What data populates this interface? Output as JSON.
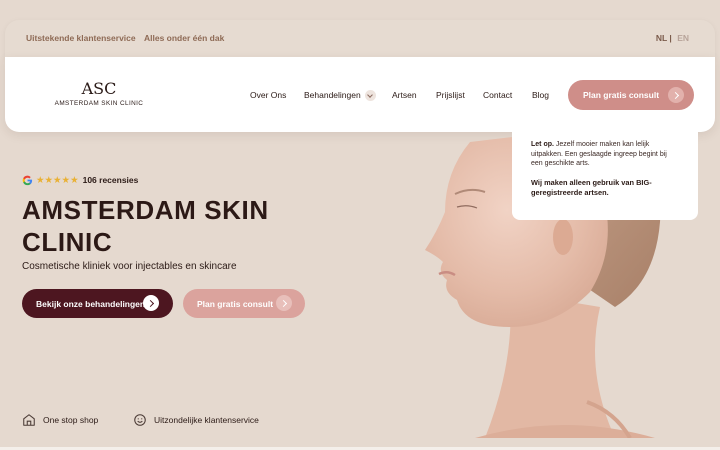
{
  "topbar": {
    "links": [
      "Uitstekende klantenservice",
      "Alles onder één dak"
    ],
    "lang_active": "NL |",
    "lang_other": "EN"
  },
  "logo": {
    "mark": "ASC",
    "wordmark": "AMSTERDAM SKIN CLINIC"
  },
  "nav": {
    "items": [
      "Over Ons",
      "Behandelingen",
      "Artsen",
      "Prijslijst",
      "Contact",
      "Blog"
    ],
    "cta": "Plan gratis consult"
  },
  "notice": {
    "lead": "Let op.",
    "body": "Jezelf mooier maken kan lelijk uitpakken. Een geslaagde ingreep begint bij een geschikte arts.",
    "strong": "Wij maken alleen gebruik van BIG-geregistreerde artsen."
  },
  "hero": {
    "rating_stars": "★★★★★",
    "rating_value": 4.5,
    "reviews": "106 recensies",
    "title": "AMSTERDAM SKIN CLINIC",
    "subtitle": "Cosmetische kliniek voor injectables en skincare",
    "primary_cta": "Bekijk onze behandelingen",
    "secondary_cta": "Plan gratis consult"
  },
  "features": [
    "One stop shop",
    "Uitzondelijke klantenservice"
  ],
  "colors": {
    "background": "#e5d9cf",
    "primary": "#4d1620",
    "accent": "#cf8e89",
    "accent_light": "#dba39d",
    "star": "#e9b134"
  },
  "icons": {
    "google": "google-icon",
    "store": "store-icon",
    "smile": "smile-icon",
    "arrow": "arrow-right-icon",
    "chevron": "chevron-down-icon"
  }
}
